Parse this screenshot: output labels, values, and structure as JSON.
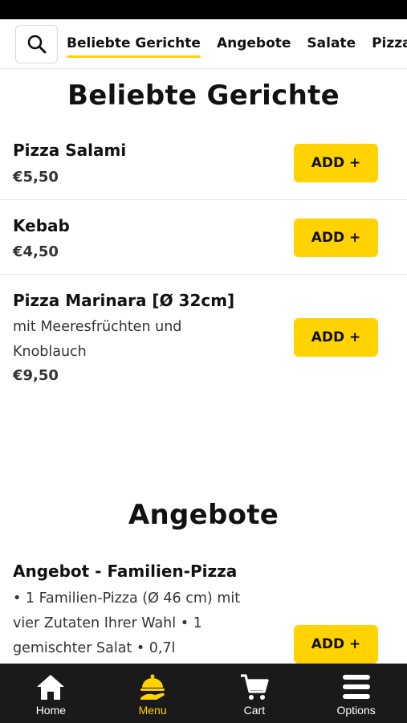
{
  "tabs": [
    {
      "label": "Beliebte Gerichte",
      "active": true
    },
    {
      "label": "Angebote",
      "active": false
    },
    {
      "label": "Salate",
      "active": false
    },
    {
      "label": "Pizza",
      "active": false
    }
  ],
  "sections": [
    {
      "title": "Beliebte Gerichte",
      "items": [
        {
          "name": "Pizza Salami",
          "desc": "",
          "price": "€5,50",
          "add_label": "ADD +"
        },
        {
          "name": "Kebab",
          "desc": "",
          "price": "€4,50",
          "add_label": "ADD +"
        },
        {
          "name": "Pizza Marinara [Ø 32cm]",
          "desc": "mit Meeresfrüchten und Knoblauch",
          "price": "€9,50",
          "add_label": "ADD +"
        }
      ]
    },
    {
      "title": "Angebote",
      "items": [
        {
          "name": "Angebot - Familien-Pizza",
          "desc": "• 1 Familien-Pizza (Ø 46 cm) mit vier Zutaten Ihrer Wahl • 1 gemischter Salat • 0,7l",
          "price": "",
          "add_label": "ADD +"
        }
      ]
    }
  ],
  "bottom_nav": [
    {
      "label": "Home",
      "icon": "home-icon",
      "active": false
    },
    {
      "label": "Menu",
      "icon": "menu-cloche-icon",
      "active": true
    },
    {
      "label": "Cart",
      "icon": "cart-icon",
      "active": false
    },
    {
      "label": "Options",
      "icon": "hamburger-icon",
      "active": false
    }
  ],
  "colors": {
    "accent": "#ffd200",
    "nav_bg": "#1a1a1a",
    "text": "#111111"
  }
}
